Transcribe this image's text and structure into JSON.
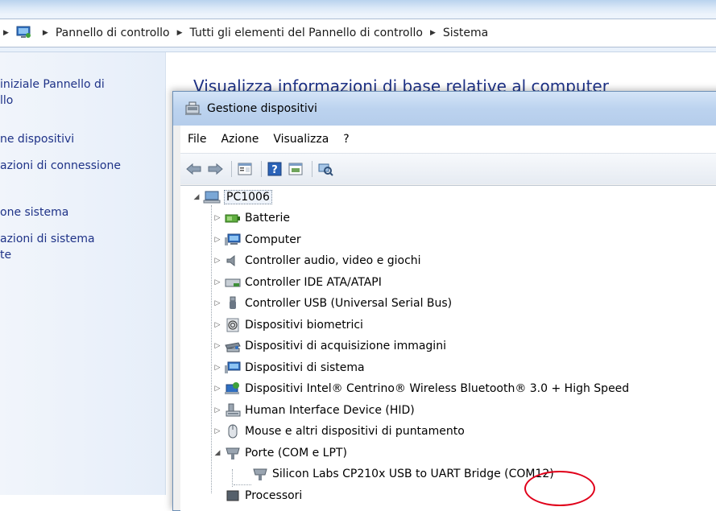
{
  "address_bar": {
    "breadcrumbs": [
      "Pannello di controllo",
      "Tutti gli elementi del Pannello di controllo",
      "Sistema"
    ]
  },
  "left_pane": {
    "links": [
      "iniziale Pannello di\nllo",
      "ne dispositivi",
      "azioni di connessione\n",
      "one sistema",
      "azioni di sistema\nte"
    ]
  },
  "background_heading": "Visualizza informazioni di base relative al computer",
  "device_manager": {
    "title": "Gestione dispositivi",
    "menu": [
      "File",
      "Azione",
      "Visualizza",
      "?"
    ],
    "toolbar_icons": [
      "back-arrow-icon",
      "forward-arrow-icon",
      "properties-icon",
      "help-icon",
      "update-driver-icon",
      "scan-hardware-icon"
    ],
    "root": "PC1006",
    "categories": [
      {
        "label": "Batterie",
        "icon": "battery-icon"
      },
      {
        "label": "Computer",
        "icon": "computer-icon"
      },
      {
        "label": "Controller audio, video e giochi",
        "icon": "speaker-icon"
      },
      {
        "label": "Controller IDE ATA/ATAPI",
        "icon": "ide-controller-icon"
      },
      {
        "label": "Controller USB (Universal Serial Bus)",
        "icon": "usb-icon"
      },
      {
        "label": "Dispositivi biometrici",
        "icon": "fingerprint-icon"
      },
      {
        "label": "Dispositivi di acquisizione immagini",
        "icon": "scanner-icon"
      },
      {
        "label": "Dispositivi di sistema",
        "icon": "system-device-icon"
      },
      {
        "label": "Dispositivi Intel® Centrino® Wireless Bluetooth® 3.0 + High Speed",
        "icon": "bluetooth-icon"
      },
      {
        "label": "Human Interface Device (HID)",
        "icon": "hid-icon"
      },
      {
        "label": "Mouse e altri dispositivi di puntamento",
        "icon": "mouse-icon"
      },
      {
        "label": "Porte (COM e LPT)",
        "icon": "port-icon"
      }
    ],
    "expanded_child": {
      "label": "Silicon Labs CP210x USB to UART Bridge (COM12)",
      "icon": "port-icon"
    },
    "partial_next": "Processori"
  },
  "colors": {
    "annotation_circle": "#e0001a",
    "link": "#1e3287"
  }
}
